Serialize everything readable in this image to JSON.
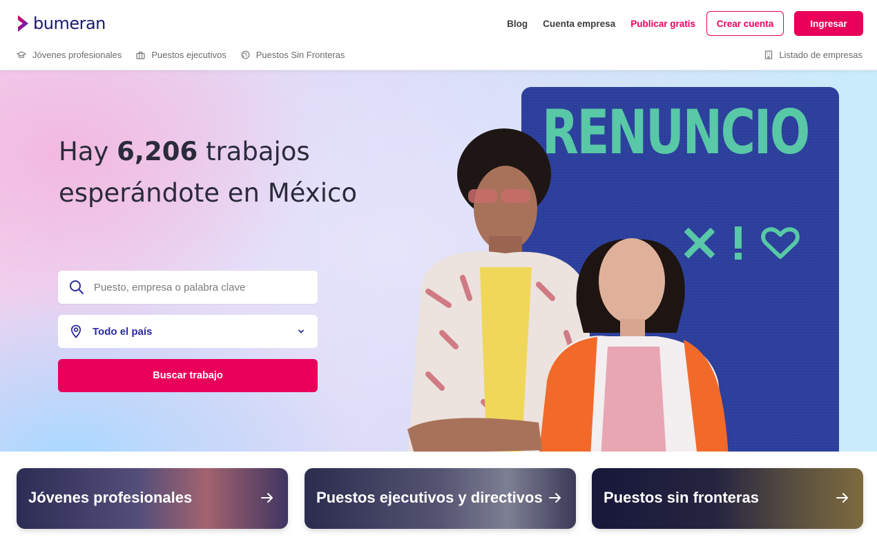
{
  "brand": {
    "name": "bumeran",
    "accent": "#e8005a",
    "navy": "#1a1a6c"
  },
  "topnav": {
    "blog": "Blog",
    "company_account": "Cuenta empresa",
    "publish_free": "Publicar gratis",
    "create_account": "Crear cuenta",
    "login": "Ingresar"
  },
  "subnav": {
    "items": [
      {
        "label": "Jóvenes profesionales",
        "icon": "graduation-cap-icon"
      },
      {
        "label": "Puestos ejecutivos",
        "icon": "briefcase-icon"
      },
      {
        "label": "Puestos Sin Fronteras",
        "icon": "globe-icon"
      }
    ],
    "companies": {
      "label": "Listado de empresas",
      "icon": "building-icon"
    }
  },
  "hero": {
    "headline_pre": "Hay ",
    "headline_count": "6,206",
    "headline_post": " trabajos esperándote en México",
    "search_placeholder": "Puesto, empresa o palabra clave",
    "location_value": "Todo el país",
    "search_button": "Buscar trabajo",
    "poster_title": "RENUNCIO",
    "poster_symbols": [
      "×",
      "!",
      "♡"
    ]
  },
  "categories": [
    {
      "label": "Jóvenes profesionales"
    },
    {
      "label": "Puestos ejecutivos y directivos"
    },
    {
      "label": "Puestos sin fronteras"
    }
  ]
}
